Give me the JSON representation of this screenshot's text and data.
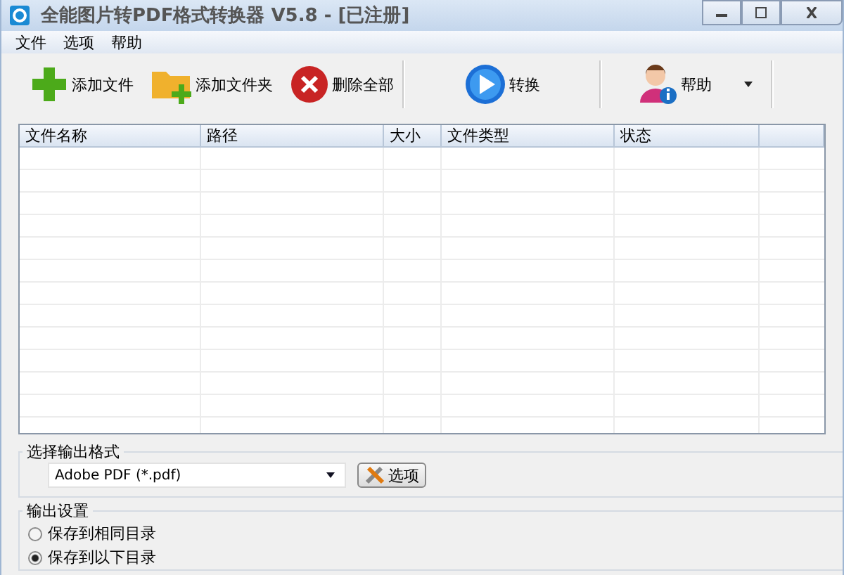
{
  "window": {
    "title": "全能图片转PDF格式转换器 V5.8 - [已注册]"
  },
  "menu": [
    "文件",
    "选项",
    "帮助"
  ],
  "toolbar": [
    {
      "kind": "add-file",
      "label": "添加文件"
    },
    {
      "kind": "add-folder",
      "label": "添加文件夹"
    },
    {
      "kind": "delete",
      "label": "删除全部"
    },
    {
      "kind": "convert",
      "label": "转换"
    },
    {
      "kind": "help",
      "label": "帮助"
    }
  ],
  "table": {
    "columns": [
      "文件名称",
      "路径",
      "大小",
      "文件类型",
      "状态"
    ]
  },
  "format_group": {
    "title": "选择输出格式",
    "format": "Adobe PDF (*.pdf)",
    "options_button": "选项"
  },
  "output_group": {
    "title": "输出设置",
    "options": [
      {
        "label": "保存到相同目录",
        "selected": false
      },
      {
        "label": "保存到以下目录",
        "selected": true
      }
    ]
  }
}
